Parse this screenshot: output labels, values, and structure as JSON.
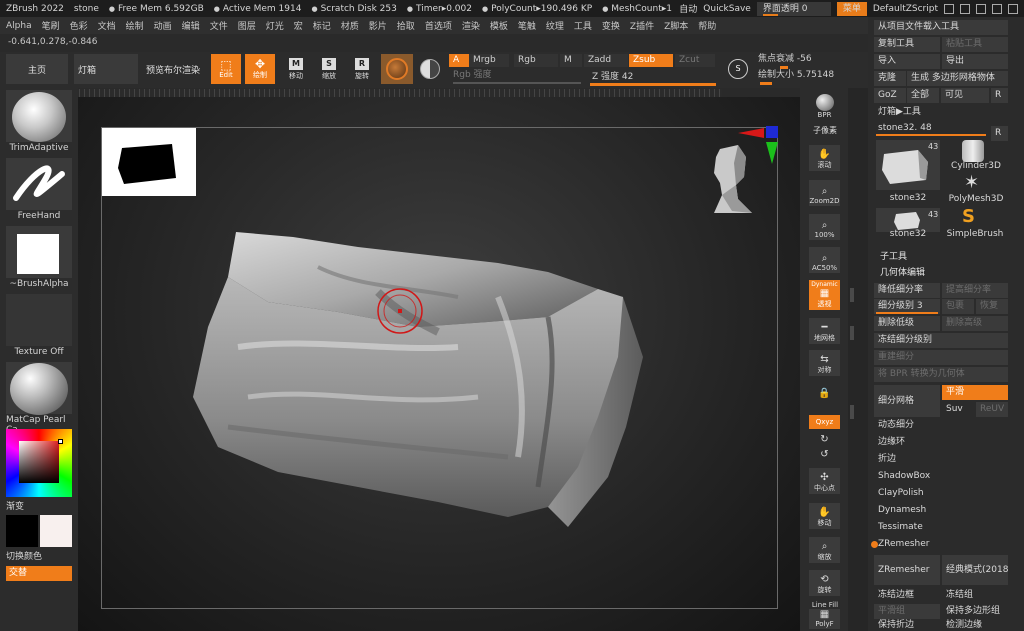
{
  "status": {
    "app_title": "ZBrush 2022",
    "tool_name": "stone",
    "free_mem": "Free Mem 6.592GB",
    "active_mem": "Active Mem 1914",
    "scratch_disk": "Scratch Disk 253",
    "timer": "Timer▸0.002",
    "polycount": "PolyCount▸190.496 KP",
    "meshcount": "MeshCount▸1",
    "auto": "自动",
    "quicksave": "QuickSave",
    "ui_transparency": "界面透明 0",
    "menus_button": "菜单",
    "default_script": "DefaultZScript"
  },
  "menu": [
    "Alpha",
    "笔刷",
    "色彩",
    "文档",
    "绘制",
    "动画",
    "编辑",
    "文件",
    "图层",
    "灯光",
    "宏",
    "标记",
    "材质",
    "影片",
    "拾取",
    "首选项",
    "渲染",
    "模板",
    "笔触",
    "纹理",
    "工具",
    "变换",
    "Z插件",
    "Z脚本",
    "帮助"
  ],
  "coords": "-0.641,0.278,-0.846",
  "toolbar": {
    "home": "主页",
    "lightbox": "灯箱",
    "live_boolean": "预览布尔渲染",
    "edit": "Edit",
    "draw": "绘制",
    "move": "移动",
    "scale": "缩放",
    "rotate": "旋转",
    "a": "A",
    "mrgb": "Mrgb",
    "rgb": "Rgb",
    "m": "M",
    "zadd": "Zadd",
    "zsub": "Zsub",
    "zcut": "Zcut",
    "rgb_intensity": "Rgb 强度",
    "z_intensity": "Z 强度 42",
    "focal_shift": "焦点衰减 -56",
    "draw_size": "绘制大小 5.75148",
    "s_label": "S"
  },
  "left_tray": {
    "brush": "TrimAdaptive",
    "stroke": "FreeHand",
    "alpha": "~BrushAlpha",
    "texture": "Texture Off",
    "material": "MatCap Pearl Ca",
    "gradient": "渐变",
    "switch_color": "切换颜色",
    "alternate": "交替"
  },
  "right_shelf": {
    "bpr": "BPR",
    "subpixel": "子像素",
    "scroll": "滚动",
    "zoom2d": "Zoom2D",
    "pct100": "100%",
    "aahalf": "AC50%",
    "dynamic": "Dynamic",
    "perspective": "透视",
    "floor": "地网格",
    "local": "对称",
    "xyz": "Qxyz",
    "center": "中心点",
    "move": "移动",
    "scale": "缩放",
    "rotate": "旋转",
    "linefill": "Line Fill",
    "polyf": "PolyF"
  },
  "right_panel": {
    "load_from_project": "从项目文件载入工具",
    "copy_tool": "复制工具",
    "paste_tool": "粘贴工具",
    "import": "导入",
    "export": "导出",
    "clone": "克隆",
    "make_polymesh": "生成 多边形网格物体",
    "goz": "GoZ",
    "all": "全部",
    "visible": "可见",
    "r": "R",
    "lightbox_tool": "灯箱▶工具",
    "stone_slider": "stone32. 48",
    "tool1_name": "stone32",
    "tool1_count": "43",
    "tool2_name": "Cylinder3D",
    "tool3_name": "PolyMesh3D",
    "tool4_name": "stone32",
    "tool4_count": "43",
    "tool5_name": "SimpleBrush",
    "subtool": "子工具",
    "geometry": "几何体编辑",
    "lower_res": "降低细分率",
    "higher_res": "提高细分率",
    "sdiv": "细分级别 3",
    "cage": "包裹",
    "rstr": "恢复",
    "del_lower": "删除低级",
    "del_higher": "删除高级",
    "freeze_sdiv": "冻结细分级别",
    "reconstruct": "重建细分",
    "bpr_to_geo": "将 BPR 转换为几何体",
    "divide": "细分网格",
    "smooth": "平滑",
    "suv": "Suv",
    "reuv": "ReUV",
    "dynamic_subdiv": "动态细分",
    "edgeloop": "边缘环",
    "crease": "折边",
    "shadowbox": "ShadowBox",
    "claypolish": "ClayPolish",
    "dynamesh": "Dynamesh",
    "tessimate": "Tessimate",
    "zremesher_hdr": "ZRemesher",
    "zremesher_btn": "ZRemesher",
    "legacy": "经典模式(2018)",
    "freeze_border": "冻结边框",
    "freeze_groups": "冻结组",
    "smooth_groups": "平滑组",
    "keep_groups": "保持多边形组",
    "keep_crease": "保持折边",
    "detect_edges": "检测边缘"
  },
  "colors": {
    "accent": "#f07d1a",
    "panel": "#2b2b2b",
    "button": "#3a3a3a"
  }
}
